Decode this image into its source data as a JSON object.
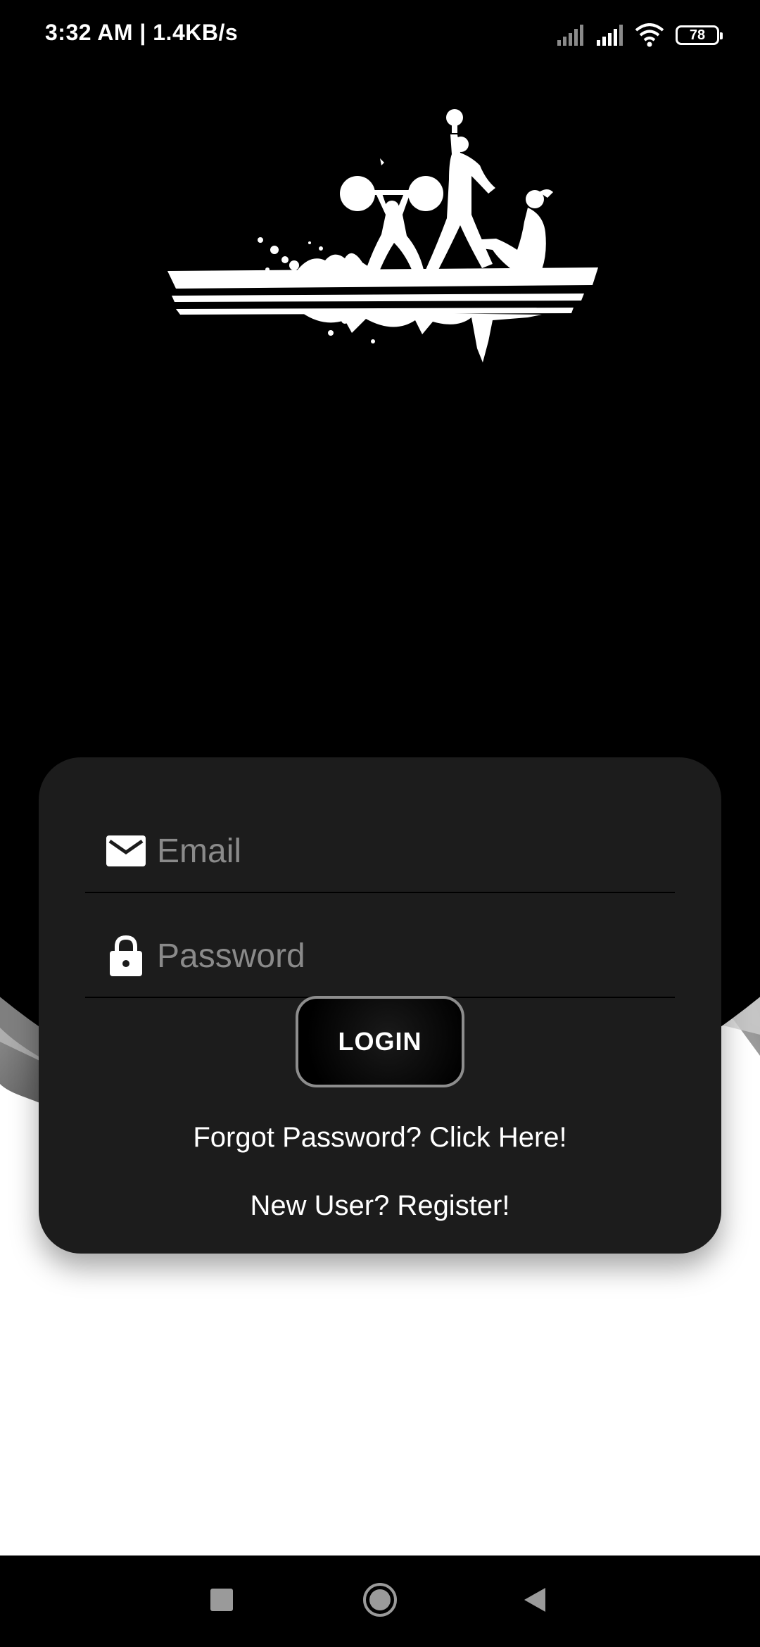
{
  "status_bar": {
    "time": "3:32 AM | 1.4KB/s",
    "battery_level": "78",
    "icons": [
      "signal-icon",
      "signal-icon",
      "wifi-icon",
      "battery-icon"
    ]
  },
  "logo": {
    "icon": "fitness-silhouettes-logo"
  },
  "login_form": {
    "email_placeholder": "Email",
    "email_value": "",
    "password_placeholder": "Password",
    "password_value": "",
    "login_label": "LOGIN",
    "forgot_label": "Forgot Password? Click Here!",
    "register_label": "New User? Register!"
  },
  "nav_bar": {
    "buttons": [
      "recents-icon",
      "home-icon",
      "back-icon"
    ]
  },
  "colors": {
    "background_dark": "#000000",
    "card": "#1c1c1c",
    "placeholder": "#8a8a8a",
    "text": "#ffffff",
    "button_border": "#8d8d8d"
  }
}
